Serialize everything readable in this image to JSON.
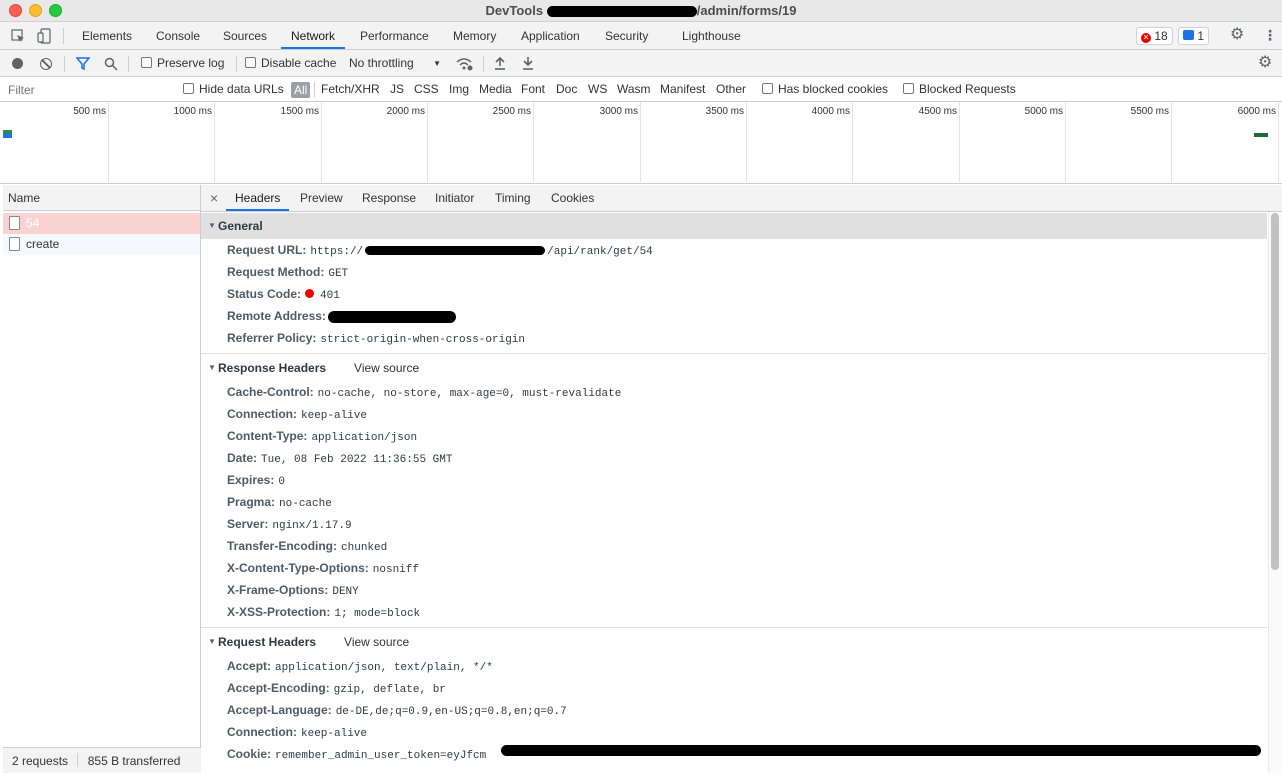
{
  "window": {
    "title_prefix": "DevTools",
    "title_suffix": "admin/forms/19"
  },
  "main_tabs": [
    "Elements",
    "Console",
    "Sources",
    "Network",
    "Performance",
    "Memory",
    "Application",
    "Security",
    "Lighthouse"
  ],
  "active_main_tab": "Network",
  "badges": {
    "errors": "18",
    "messages": "1"
  },
  "toolbar": {
    "preserve_log": "Preserve log",
    "disable_cache": "Disable cache",
    "throttling": "No throttling"
  },
  "filter": {
    "placeholder": "Filter",
    "hide_data_urls": "Hide data URLs",
    "types": [
      "All",
      "Fetch/XHR",
      "JS",
      "CSS",
      "Img",
      "Media",
      "Font",
      "Doc",
      "WS",
      "Wasm",
      "Manifest",
      "Other"
    ],
    "has_blocked_cookies": "Has blocked cookies",
    "blocked_requests": "Blocked Requests"
  },
  "timeline": {
    "labels": [
      "500 ms",
      "1000 ms",
      "1500 ms",
      "2000 ms",
      "2500 ms",
      "3000 ms",
      "3500 ms",
      "4000 ms",
      "4500 ms",
      "5000 ms",
      "5500 ms",
      "6000 ms"
    ]
  },
  "requests": {
    "header": "Name",
    "items": [
      "54",
      "create"
    ]
  },
  "status": {
    "requests": "2 requests",
    "transferred": "855 B transferred"
  },
  "detail_tabs": [
    "Headers",
    "Preview",
    "Response",
    "Initiator",
    "Timing",
    "Cookies"
  ],
  "active_detail_tab": "Headers",
  "general": {
    "title": "General",
    "request_url_label": "Request URL:",
    "request_url_prefix": "https://",
    "request_url_suffix": "/api/rank/get/54",
    "request_method_label": "Request Method:",
    "request_method": "GET",
    "status_code_label": "Status Code:",
    "status_code": "401",
    "remote_address_label": "Remote Address:",
    "referrer_policy_label": "Referrer Policy:",
    "referrer_policy": "strict-origin-when-cross-origin"
  },
  "response_headers": {
    "title": "Response Headers",
    "view_source": "View source",
    "rows": [
      {
        "name": "Cache-Control:",
        "value": "no-cache, no-store, max-age=0, must-revalidate"
      },
      {
        "name": "Connection:",
        "value": "keep-alive"
      },
      {
        "name": "Content-Type:",
        "value": "application/json"
      },
      {
        "name": "Date:",
        "value": "Tue, 08 Feb 2022 11:36:55 GMT"
      },
      {
        "name": "Expires:",
        "value": "0"
      },
      {
        "name": "Pragma:",
        "value": "no-cache"
      },
      {
        "name": "Server:",
        "value": "nginx/1.17.9"
      },
      {
        "name": "Transfer-Encoding:",
        "value": "chunked"
      },
      {
        "name": "X-Content-Type-Options:",
        "value": "nosniff"
      },
      {
        "name": "X-Frame-Options:",
        "value": "DENY"
      },
      {
        "name": "X-XSS-Protection:",
        "value": "1; mode=block"
      }
    ]
  },
  "request_headers": {
    "title": "Request Headers",
    "view_source": "View source",
    "rows": [
      {
        "name": "Accept:",
        "value": "application/json, text/plain, */*"
      },
      {
        "name": "Accept-Encoding:",
        "value": "gzip, deflate, br"
      },
      {
        "name": "Accept-Language:",
        "value": "de-DE,de;q=0.9,en-US;q=0.8,en;q=0.7"
      },
      {
        "name": "Connection:",
        "value": "keep-alive"
      },
      {
        "name": "Cookie:",
        "value": "remember_admin_user_token=eyJfcm"
      }
    ]
  },
  "colors": {
    "accent": "#1a73e8",
    "error_row": "#fad2d2",
    "status_dot": "#e00000"
  }
}
